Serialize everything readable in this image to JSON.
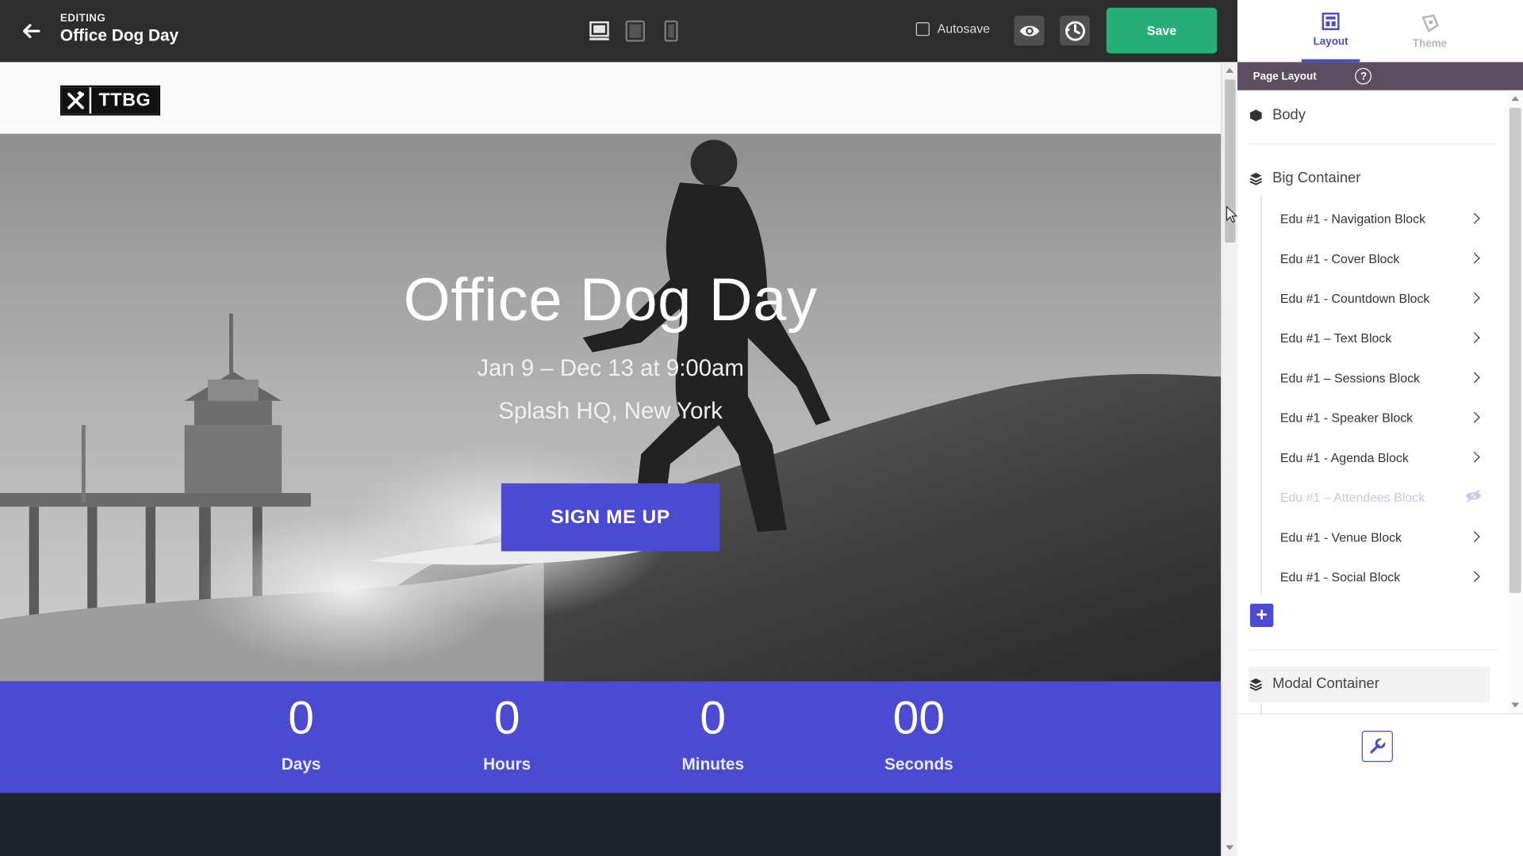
{
  "header": {
    "editing_label": "EDITING",
    "title": "Office Dog Day",
    "autosave_label": "Autosave",
    "save_label": "Save"
  },
  "site": {
    "logo_text": "TTBG",
    "cover": {
      "title": "Office Dog Day",
      "date": "Jan 9 – Dec 13 at 9:00am",
      "venue": "Splash HQ, New York",
      "button": "SIGN ME UP"
    },
    "countdown": [
      {
        "value": "0",
        "label": "Days"
      },
      {
        "value": "0",
        "label": "Hours"
      },
      {
        "value": "0",
        "label": "Minutes"
      },
      {
        "value": "00",
        "label": "Seconds"
      }
    ]
  },
  "panel": {
    "tabs": [
      {
        "label": "Layout",
        "icon": "layout-icon",
        "active": true
      },
      {
        "label": "Theme",
        "icon": "theme-icon",
        "active": false
      }
    ],
    "header": "Page Layout",
    "sections": {
      "body": "Body",
      "big_container": "Big Container",
      "modal_container": "Modal Container"
    },
    "blocks": [
      {
        "label": "Edu #1 - Navigation Block",
        "hidden": false
      },
      {
        "label": "Edu #1 - Cover Block",
        "hidden": false
      },
      {
        "label": "Edu #1 - Countdown Block",
        "hidden": false
      },
      {
        "label": "Edu #1 – Text Block",
        "hidden": false
      },
      {
        "label": "Edu #1 – Sessions Block",
        "hidden": false
      },
      {
        "label": "Edu #1 - Speaker Block",
        "hidden": false
      },
      {
        "label": "Edu #1 - Agenda Block",
        "hidden": false
      },
      {
        "label": "Edu #1 – Attendees Block",
        "hidden": true
      },
      {
        "label": "Edu #1 - Venue Block",
        "hidden": false
      },
      {
        "label": "Edu #1 - Social Block",
        "hidden": false
      }
    ]
  },
  "colors": {
    "accent": "#4b4bd1",
    "save_green": "#26ad78",
    "topbar": "#2d2d2d",
    "panel_header": "#5c4d60"
  }
}
